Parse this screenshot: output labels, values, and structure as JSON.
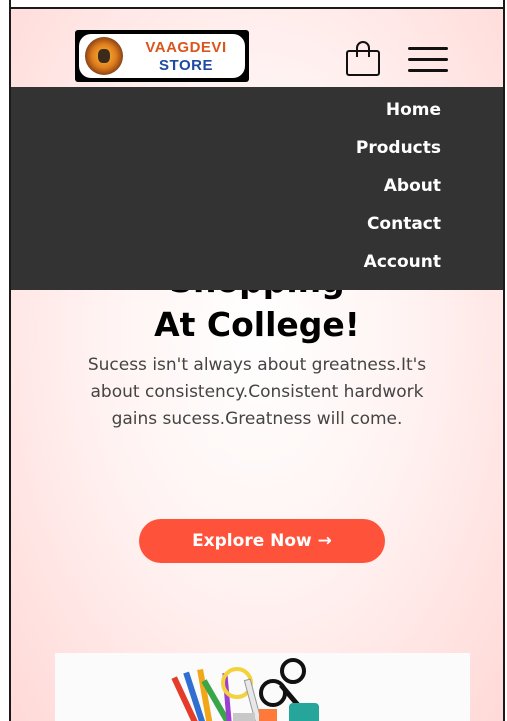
{
  "header": {
    "logo": {
      "line1": "VAAGDEVI",
      "line2": "STORE"
    },
    "cart_icon": "shopping-bag-icon",
    "menu_icon": "hamburger-menu-icon"
  },
  "nav": {
    "items": [
      {
        "label": "Home"
      },
      {
        "label": "Products"
      },
      {
        "label": "About"
      },
      {
        "label": "Contact"
      },
      {
        "label": "Account"
      }
    ]
  },
  "hero": {
    "title_line1": "Shopping",
    "title_line2": "At College!",
    "description": "Sucess isn't always about greatness.It's about consistency.Consistent hardwork gains sucess.Greatness will come.",
    "cta_label": "Explore Now →"
  },
  "colors": {
    "accent": "#ff523b",
    "menu_bg": "#333333",
    "hero_bg": "#ffd9d7"
  }
}
